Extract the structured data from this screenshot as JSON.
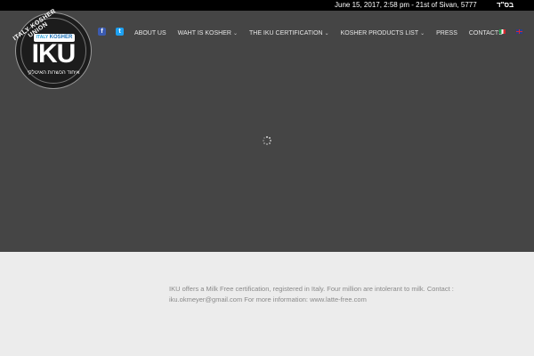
{
  "topbar": {
    "date_text": "June 15, 2017, 2:58 pm - 21st of Sivan, 5777",
    "bsd": "בס\"ד"
  },
  "logo": {
    "arc_text": "ITALY KOSHER UNION",
    "band_italy": "ITALY",
    "band_kosher": "KOSHER",
    "band_list": "LIST",
    "wordmark": "IKU",
    "hebrew_text": "איחוד הכשרות האיטלקי"
  },
  "social": {
    "facebook_glyph": "f",
    "twitter_glyph": "t"
  },
  "nav": {
    "items": [
      {
        "label": "ABOUT US",
        "dropdown": false
      },
      {
        "label": "WAHT IS KOSHER",
        "dropdown": true
      },
      {
        "label": "THE IKU CERTIFICATION",
        "dropdown": true
      },
      {
        "label": "KOSHER PRODUCTS LIST",
        "dropdown": true
      },
      {
        "label": "PRESS",
        "dropdown": false
      },
      {
        "label": "CONTACTS",
        "dropdown": false
      }
    ],
    "chevron": "⌄"
  },
  "languages": [
    "italian-flag",
    "english-flag"
  ],
  "footer": {
    "line1": "IKU offers a Milk Free certification, registered in Italy. Four million are intolerant to milk. Contact :",
    "line2": "iku.okmeyer@gmail.com For more information:  www.latte-free.com"
  },
  "colors": {
    "topbar_bg": "#000000",
    "hero_bg": "#454545",
    "footer_bg": "#ececec",
    "facebook": "#3b5bb0",
    "twitter": "#1da1f2"
  }
}
